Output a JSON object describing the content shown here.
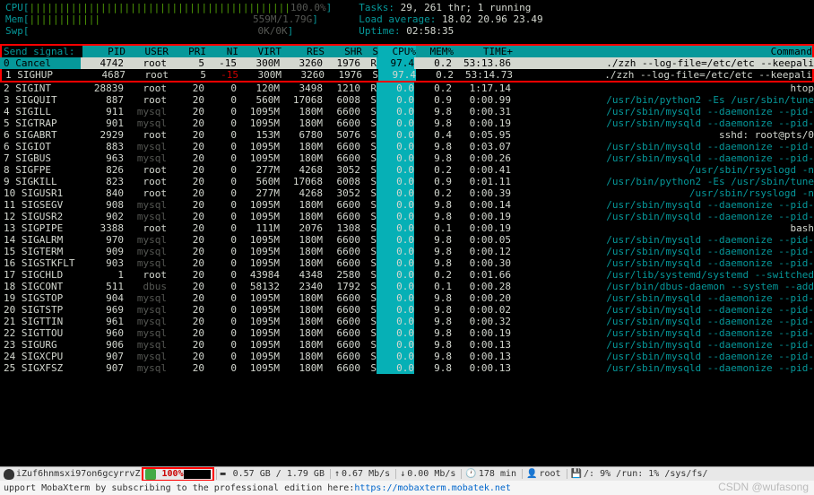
{
  "header": {
    "cpu_label": "CPU",
    "cpu_bar": "||||||||||||||||||||||||||||||||||||||||||||",
    "cpu_pct": "100.0%",
    "mem_label": "Mem",
    "mem_bar": "||||||||||||",
    "mem_val": "559M/1.79G",
    "swp_label": "Swp",
    "swp_val": "0K/0K",
    "tasks_label": "Tasks:",
    "tasks_val": "29, 261 thr; 1 running",
    "load_label": "Load average:",
    "load_val": "18.02 20.96 23.49",
    "uptime_label": "Uptime:",
    "uptime_val": "02:58:35"
  },
  "signal_title": "Send signal:",
  "signal_cancel": "0  Cancel",
  "columns": {
    "pid": "PID",
    "user": "USER",
    "pri": "PRI",
    "ni": "NI",
    "virt": "VIRT",
    "res": "RES",
    "shr": "SHR",
    "s": "S",
    "cpu": "CPU%",
    "mem": "MEM%",
    "time": "TIME+",
    "cmd": "Command"
  },
  "signals": [
    "1  SIGHUP",
    "2  SIGINT",
    "3  SIGQUIT",
    "4  SIGILL",
    "5  SIGTRAP",
    "6  SIGABRT",
    "6  SIGIOT",
    "7  SIGBUS",
    "8  SIGFPE",
    "9  SIGKILL",
    "10 SIGUSR1",
    "11 SIGSEGV",
    "12 SIGUSR2",
    "13 SIGPIPE",
    "14 SIGALRM",
    "15 SIGTERM",
    "16 SIGSTKFLT",
    "17 SIGCHLD",
    "18 SIGCONT",
    "19 SIGSTOP",
    "20 SIGTSTP",
    "21 SIGTTIN",
    "22 SIGTTOU",
    "23 SIGURG",
    "24 SIGXCPU",
    "25 SIGXFSZ"
  ],
  "rows": [
    {
      "pid": "4742",
      "user": "root",
      "pri": "5",
      "ni": "-15",
      "virt": "300M",
      "res": "3260",
      "shr": "1976",
      "s": "R",
      "cpu": "97.4",
      "mem": "0.2",
      "time": "53:13.86",
      "cmd": "./zzh --log-file=/etc/etc --keepali",
      "sel": true
    },
    {
      "pid": "4687",
      "user": "root",
      "pri": "5",
      "ni": "-15",
      "virt": "300M",
      "res": "3260",
      "shr": "1976",
      "s": "S",
      "cpu": "97.4",
      "mem": "0.2",
      "time": "53:14.73",
      "cmd": "./zzh --log-file=/etc/etc --keepali",
      "r2": true
    },
    {
      "pid": "28839",
      "user": "root",
      "pri": "20",
      "ni": "0",
      "virt": "120M",
      "res": "3498",
      "shr": "1210",
      "s": "R",
      "cpu": "0.0",
      "mem": "0.2",
      "time": "1:17.14",
      "cmd": "htop"
    },
    {
      "pid": "887",
      "user": "root",
      "pri": "20",
      "ni": "0",
      "virt": "560M",
      "res": "17068",
      "shr": "6008",
      "s": "S",
      "cpu": "0.0",
      "mem": "0.9",
      "time": "0:00.99",
      "cmd": "/usr/bin/python2 -Es /usr/sbin/tune",
      "path": true
    },
    {
      "pid": "911",
      "user": "mysql",
      "pri": "20",
      "ni": "0",
      "virt": "1095M",
      "res": "180M",
      "shr": "6600",
      "s": "S",
      "cpu": "0.0",
      "mem": "9.8",
      "time": "0:00.31",
      "cmd": "/usr/sbin/mysqld --daemonize --pid-",
      "path": true
    },
    {
      "pid": "901",
      "user": "mysql",
      "pri": "20",
      "ni": "0",
      "virt": "1095M",
      "res": "180M",
      "shr": "6600",
      "s": "S",
      "cpu": "0.0",
      "mem": "9.8",
      "time": "0:00.19",
      "cmd": "/usr/sbin/mysqld --daemonize --pid-",
      "path": true
    },
    {
      "pid": "2929",
      "user": "root",
      "pri": "20",
      "ni": "0",
      "virt": "153M",
      "res": "6780",
      "shr": "5076",
      "s": "S",
      "cpu": "0.0",
      "mem": "0.4",
      "time": "0:05.95",
      "cmd": "sshd: root@pts/0"
    },
    {
      "pid": "883",
      "user": "mysql",
      "pri": "20",
      "ni": "0",
      "virt": "1095M",
      "res": "180M",
      "shr": "6600",
      "s": "S",
      "cpu": "0.0",
      "mem": "9.8",
      "time": "0:03.07",
      "cmd": "/usr/sbin/mysqld --daemonize --pid-",
      "path": true
    },
    {
      "pid": "963",
      "user": "mysql",
      "pri": "20",
      "ni": "0",
      "virt": "1095M",
      "res": "180M",
      "shr": "6600",
      "s": "S",
      "cpu": "0.0",
      "mem": "9.8",
      "time": "0:00.26",
      "cmd": "/usr/sbin/mysqld --daemonize --pid-",
      "path": true
    },
    {
      "pid": "826",
      "user": "root",
      "pri": "20",
      "ni": "0",
      "virt": "277M",
      "res": "4268",
      "shr": "3052",
      "s": "S",
      "cpu": "0.0",
      "mem": "0.2",
      "time": "0:00.41",
      "cmd": "/usr/sbin/rsyslogd -n",
      "path": true
    },
    {
      "pid": "823",
      "user": "root",
      "pri": "20",
      "ni": "0",
      "virt": "560M",
      "res": "17068",
      "shr": "6008",
      "s": "S",
      "cpu": "0.0",
      "mem": "0.9",
      "time": "0:01.11",
      "cmd": "/usr/bin/python2 -Es /usr/sbin/tune",
      "path": true
    },
    {
      "pid": "840",
      "user": "root",
      "pri": "20",
      "ni": "0",
      "virt": "277M",
      "res": "4268",
      "shr": "3052",
      "s": "S",
      "cpu": "0.0",
      "mem": "0.2",
      "time": "0:00.39",
      "cmd": "/usr/sbin/rsyslogd -n",
      "path": true
    },
    {
      "pid": "908",
      "user": "mysql",
      "pri": "20",
      "ni": "0",
      "virt": "1095M",
      "res": "180M",
      "shr": "6600",
      "s": "S",
      "cpu": "0.0",
      "mem": "9.8",
      "time": "0:00.14",
      "cmd": "/usr/sbin/mysqld --daemonize --pid-",
      "path": true
    },
    {
      "pid": "902",
      "user": "mysql",
      "pri": "20",
      "ni": "0",
      "virt": "1095M",
      "res": "180M",
      "shr": "6600",
      "s": "S",
      "cpu": "0.0",
      "mem": "9.8",
      "time": "0:00.19",
      "cmd": "/usr/sbin/mysqld --daemonize --pid-",
      "path": true
    },
    {
      "pid": "3388",
      "user": "root",
      "pri": "20",
      "ni": "0",
      "virt": "111M",
      "res": "2076",
      "shr": "1308",
      "s": "S",
      "cpu": "0.0",
      "mem": "0.1",
      "time": "0:00.19",
      "cmd": "bash"
    },
    {
      "pid": "970",
      "user": "mysql",
      "pri": "20",
      "ni": "0",
      "virt": "1095M",
      "res": "180M",
      "shr": "6600",
      "s": "S",
      "cpu": "0.0",
      "mem": "9.8",
      "time": "0:00.05",
      "cmd": "/usr/sbin/mysqld --daemonize --pid-",
      "path": true
    },
    {
      "pid": "909",
      "user": "mysql",
      "pri": "20",
      "ni": "0",
      "virt": "1095M",
      "res": "180M",
      "shr": "6600",
      "s": "S",
      "cpu": "0.0",
      "mem": "9.8",
      "time": "0:00.12",
      "cmd": "/usr/sbin/mysqld --daemonize --pid-",
      "path": true
    },
    {
      "pid": "903",
      "user": "mysql",
      "pri": "20",
      "ni": "0",
      "virt": "1095M",
      "res": "180M",
      "shr": "6600",
      "s": "S",
      "cpu": "0.0",
      "mem": "9.8",
      "time": "0:00.30",
      "cmd": "/usr/sbin/mysqld --daemonize --pid-",
      "path": true
    },
    {
      "pid": "1",
      "user": "root",
      "pri": "20",
      "ni": "0",
      "virt": "43984",
      "res": "4348",
      "shr": "2580",
      "s": "S",
      "cpu": "0.0",
      "mem": "0.2",
      "time": "0:01.66",
      "cmd": "/usr/lib/systemd/systemd --switched",
      "path": true
    },
    {
      "pid": "511",
      "user": "dbus",
      "pri": "20",
      "ni": "0",
      "virt": "58132",
      "res": "2340",
      "shr": "1792",
      "s": "S",
      "cpu": "0.0",
      "mem": "0.1",
      "time": "0:00.28",
      "cmd": "/usr/bin/dbus-daemon --system --add",
      "path": true
    },
    {
      "pid": "904",
      "user": "mysql",
      "pri": "20",
      "ni": "0",
      "virt": "1095M",
      "res": "180M",
      "shr": "6600",
      "s": "S",
      "cpu": "0.0",
      "mem": "9.8",
      "time": "0:00.20",
      "cmd": "/usr/sbin/mysqld --daemonize --pid-",
      "path": true
    },
    {
      "pid": "969",
      "user": "mysql",
      "pri": "20",
      "ni": "0",
      "virt": "1095M",
      "res": "180M",
      "shr": "6600",
      "s": "S",
      "cpu": "0.0",
      "mem": "9.8",
      "time": "0:00.02",
      "cmd": "/usr/sbin/mysqld --daemonize --pid-",
      "path": true
    },
    {
      "pid": "961",
      "user": "mysql",
      "pri": "20",
      "ni": "0",
      "virt": "1095M",
      "res": "180M",
      "shr": "6600",
      "s": "S",
      "cpu": "0.0",
      "mem": "9.8",
      "time": "0:00.32",
      "cmd": "/usr/sbin/mysqld --daemonize --pid-",
      "path": true
    },
    {
      "pid": "960",
      "user": "mysql",
      "pri": "20",
      "ni": "0",
      "virt": "1095M",
      "res": "180M",
      "shr": "6600",
      "s": "S",
      "cpu": "0.0",
      "mem": "9.8",
      "time": "0:00.19",
      "cmd": "/usr/sbin/mysqld --daemonize --pid-",
      "path": true
    },
    {
      "pid": "906",
      "user": "mysql",
      "pri": "20",
      "ni": "0",
      "virt": "1095M",
      "res": "180M",
      "shr": "6600",
      "s": "S",
      "cpu": "0.0",
      "mem": "9.8",
      "time": "0:00.13",
      "cmd": "/usr/sbin/mysqld --daemonize --pid-",
      "path": true
    },
    {
      "pid": "907",
      "user": "mysql",
      "pri": "20",
      "ni": "0",
      "virt": "1095M",
      "res": "180M",
      "shr": "6600",
      "s": "S",
      "cpu": "0.0",
      "mem": "9.8",
      "time": "0:00.13",
      "cmd": "/usr/sbin/mysqld --daemonize --pid-",
      "path": true
    },
    {
      "pid": "907",
      "user": "mysql",
      "pri": "20",
      "ni": "0",
      "virt": "1095M",
      "res": "180M",
      "shr": "6600",
      "s": "S",
      "cpu": "0.0",
      "mem": "9.8",
      "time": "0:00.13",
      "cmd": "/usr/sbin/mysqld --daemonize --pid-",
      "path": true
    }
  ],
  "bottom": {
    "host": "iZuf6hnmsxi97on6gcyrrvZ",
    "cpu_pct": "100%",
    "mem": "0.57 GB / 1.79 GB",
    "net_up": "0.67 Mb/s",
    "net_dn": "0.00 Mb/s",
    "uptime": "178 min",
    "user": "root",
    "stats": "/: 9%   /run: 1%   /sys/fs/"
  },
  "footer": {
    "text": "upport MobaXterm by subscribing to the professional edition here: ",
    "link": "https://mobaxterm.mobatek.net"
  },
  "watermark": "CSDN @wufasong"
}
